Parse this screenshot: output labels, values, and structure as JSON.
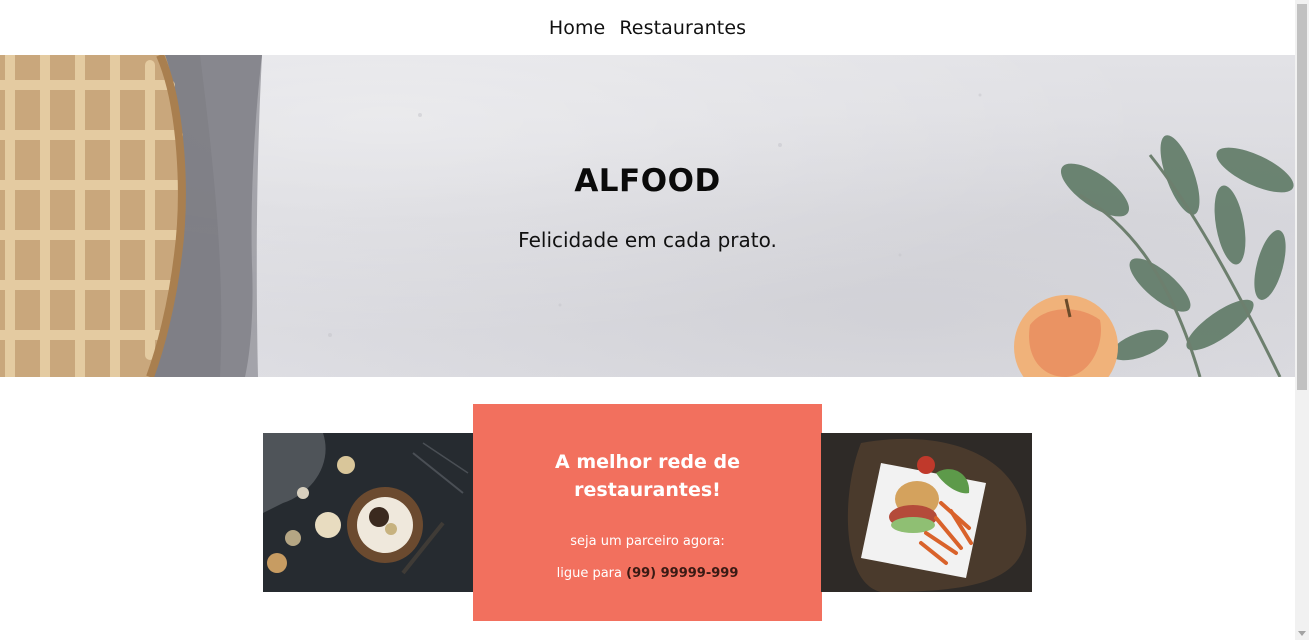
{
  "nav": {
    "items": [
      {
        "label": "Home"
      },
      {
        "label": "Restaurantes"
      }
    ]
  },
  "hero": {
    "title": "ALFOOD",
    "subtitle": "Felicidade em cada prato."
  },
  "promo": {
    "heading": "A melhor rede de restaurantes!",
    "line1": "seja um parceiro agora:",
    "line2_prefix": "ligue para ",
    "phone": "(99) 99999-999",
    "card_color": "#f2705e"
  },
  "images": {
    "hero_left": "pie-image",
    "hero_right": "leaves-apple-image",
    "promo_left": "table-food-image",
    "promo_right": "burger-fries-image"
  }
}
